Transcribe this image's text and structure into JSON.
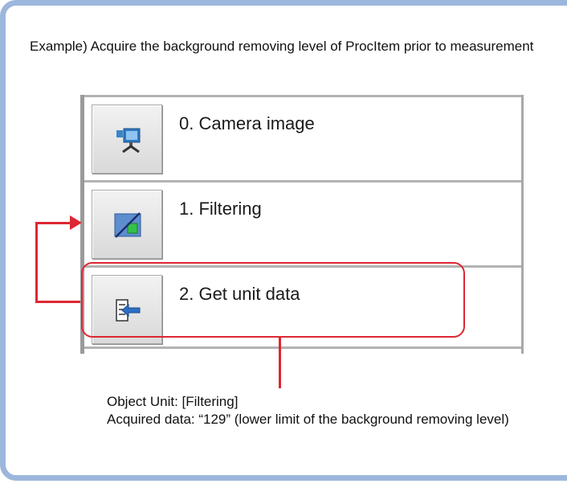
{
  "intro_text": "Example) Acquire the background removing level of ProcItem prior to measurement",
  "items": [
    {
      "label": "0. Camera image",
      "icon": "camera-image-icon"
    },
    {
      "label": "1. Filtering",
      "icon": "filtering-icon"
    },
    {
      "label": "2. Get unit data",
      "icon": "get-unit-data-icon"
    }
  ],
  "callout": {
    "object_unit": "Object Unit: [Filtering]",
    "acquired_data": "Acquired data: “129” (lower limit of the background removing level)"
  },
  "colors": {
    "frame": "#9cb7dc",
    "annotation": "#dd2733"
  }
}
